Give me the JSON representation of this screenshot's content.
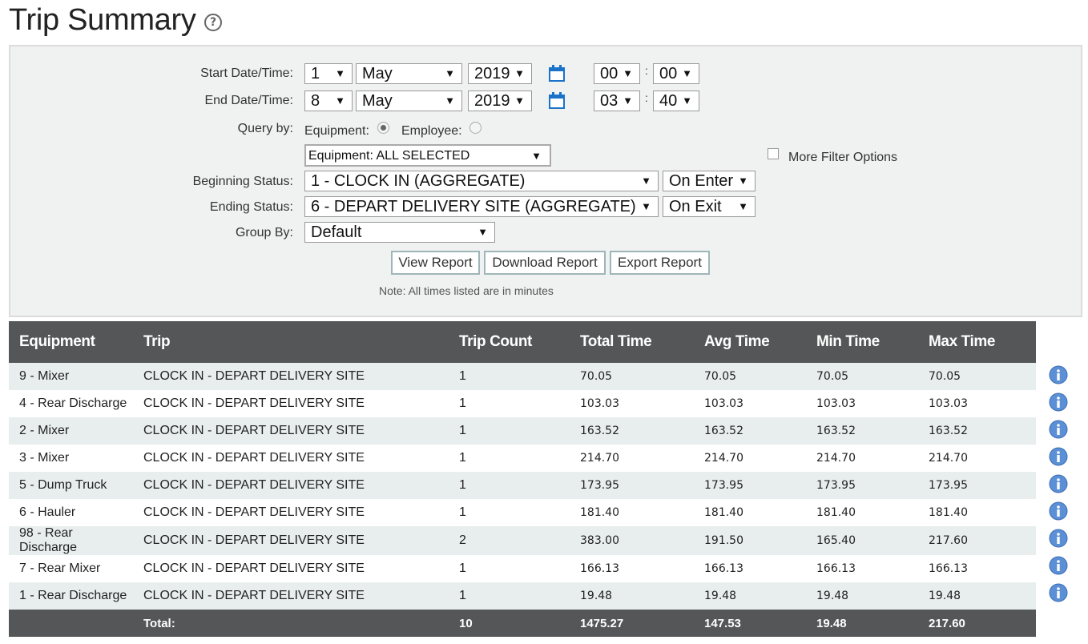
{
  "page": {
    "title": "Trip Summary"
  },
  "filters": {
    "start_label": "Start Date/Time:",
    "start": {
      "day": "1",
      "month": "May",
      "year": "2019",
      "hour": "00",
      "minute": "00"
    },
    "end_label": "End Date/Time:",
    "end": {
      "day": "8",
      "month": "May",
      "year": "2019",
      "hour": "03",
      "minute": "40"
    },
    "time_separator": ":",
    "query_by_label": "Query by:",
    "equipment_label": "Equipment:",
    "employee_label": "Employee:",
    "query_by_selected": "Equipment",
    "equipment_select": "Equipment: ALL SELECTED",
    "more_filter_label": "More Filter Options",
    "beginning_status_label": "Beginning Status:",
    "beginning_status": "1 - CLOCK IN (AGGREGATE)",
    "beginning_trigger": "On Enter",
    "ending_status_label": "Ending Status:",
    "ending_status": "6 - DEPART DELIVERY SITE (AGGREGATE)",
    "ending_trigger": "On Exit",
    "group_by_label": "Group By:",
    "group_by": "Default",
    "view_report": "View Report",
    "download_report": "Download Report",
    "export_report": "Export Report",
    "note": "Note: All times listed are in minutes",
    "dropdown_arrow": "▼"
  },
  "table": {
    "headers": [
      "Equipment",
      "Trip",
      "Trip Count",
      "Total Time",
      "Avg Time",
      "Min Time",
      "Max Time"
    ],
    "rows": [
      [
        "9 - Mixer",
        "CLOCK IN - DEPART DELIVERY SITE",
        "1",
        "70.05",
        "70.05",
        "70.05",
        "70.05"
      ],
      [
        "4 - Rear Discharge",
        "CLOCK IN - DEPART DELIVERY SITE",
        "1",
        "103.03",
        "103.03",
        "103.03",
        "103.03"
      ],
      [
        "2 - Mixer",
        "CLOCK IN - DEPART DELIVERY SITE",
        "1",
        "163.52",
        "163.52",
        "163.52",
        "163.52"
      ],
      [
        "3 - Mixer",
        "CLOCK IN - DEPART DELIVERY SITE",
        "1",
        "214.70",
        "214.70",
        "214.70",
        "214.70"
      ],
      [
        "5 - Dump Truck",
        "CLOCK IN - DEPART DELIVERY SITE",
        "1",
        "173.95",
        "173.95",
        "173.95",
        "173.95"
      ],
      [
        "6 - Hauler",
        "CLOCK IN - DEPART DELIVERY SITE",
        "1",
        "181.40",
        "181.40",
        "181.40",
        "181.40"
      ],
      [
        "98 - Rear Discharge",
        "CLOCK IN - DEPART DELIVERY SITE",
        "2",
        "383.00",
        "191.50",
        "165.40",
        "217.60"
      ],
      [
        "7 - Rear Mixer",
        "CLOCK IN - DEPART DELIVERY SITE",
        "1",
        "166.13",
        "166.13",
        "166.13",
        "166.13"
      ],
      [
        "1 - Rear Discharge",
        "CLOCK IN - DEPART DELIVERY SITE",
        "1",
        "19.48",
        "19.48",
        "19.48",
        "19.48"
      ]
    ],
    "total": {
      "label": "Total:",
      "trip_count": "10",
      "total_time": "1475.27",
      "avg_time": "147.53",
      "min_time": "19.48",
      "max_time": "217.60"
    }
  },
  "icons": {
    "help": "help-circle-icon",
    "calendar": "calendar-icon",
    "info": "info-icon"
  },
  "colors": {
    "header_bg": "#555658",
    "stripe": "#e8eeee",
    "accent_blue": "#1a73c8",
    "info_blue": "#5b8fd6"
  }
}
